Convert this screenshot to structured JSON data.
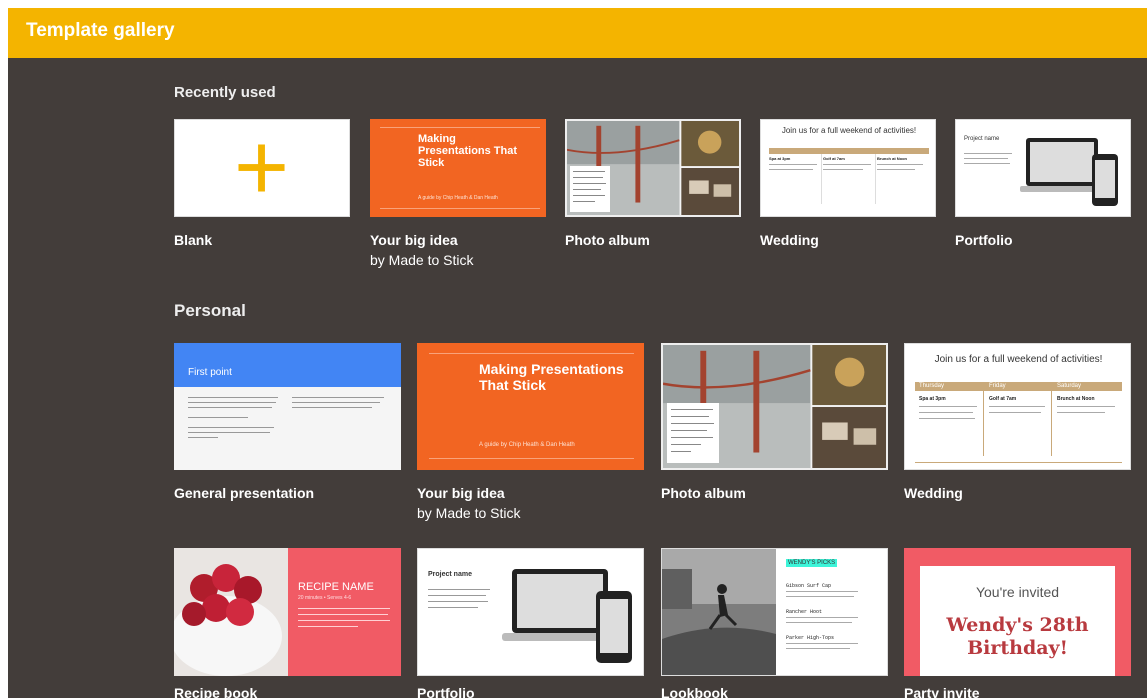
{
  "header": {
    "title": "Template gallery"
  },
  "colors": {
    "accent": "#f4b400",
    "background": "#433d3a"
  },
  "sections": {
    "recent": {
      "title": "Recently used",
      "cards": [
        {
          "label": "Blank",
          "sub": ""
        },
        {
          "label": "Your big idea",
          "sub": "by Made to Stick"
        },
        {
          "label": "Photo album",
          "sub": ""
        },
        {
          "label": "Wedding",
          "sub": ""
        },
        {
          "label": "Portfolio",
          "sub": ""
        }
      ]
    },
    "personal": {
      "title": "Personal",
      "cards": [
        {
          "label": "General presentation",
          "sub": ""
        },
        {
          "label": "Your big idea",
          "sub": "by Made to Stick"
        },
        {
          "label": "Photo album",
          "sub": ""
        },
        {
          "label": "Wedding",
          "sub": ""
        },
        {
          "label": "Recipe book",
          "sub": ""
        },
        {
          "label": "Portfolio",
          "sub": ""
        },
        {
          "label": "Lookbook",
          "sub": ""
        },
        {
          "label": "Party invite",
          "sub": ""
        }
      ]
    }
  },
  "thumbs": {
    "bigidea_title": "Making Presentations That Stick",
    "bigidea_byline": "A guide by Chip Heath & Dan Heath",
    "wedding_heading": "Join us for a full weekend of activities!",
    "wedding_cols": [
      "Thursday",
      "Friday",
      "Saturday"
    ],
    "wedding_events": [
      "Spa at 3pm",
      "Golf at 7am",
      "Brunch at Noon"
    ],
    "portfolio_title": "Project name",
    "general_heading": "First point",
    "recipe_title": "RECIPE NAME",
    "recipe_meta": "20 minutes • Serves 4-6",
    "lookbook_title": "WENDY'S PICKS",
    "lookbook_items": [
      "Gibson Surf Cap",
      "Rancher Hoot",
      "Parker High-Tops"
    ],
    "invite_top": "You're invited",
    "invite_name": "Wendy's 28th Birthday!"
  }
}
